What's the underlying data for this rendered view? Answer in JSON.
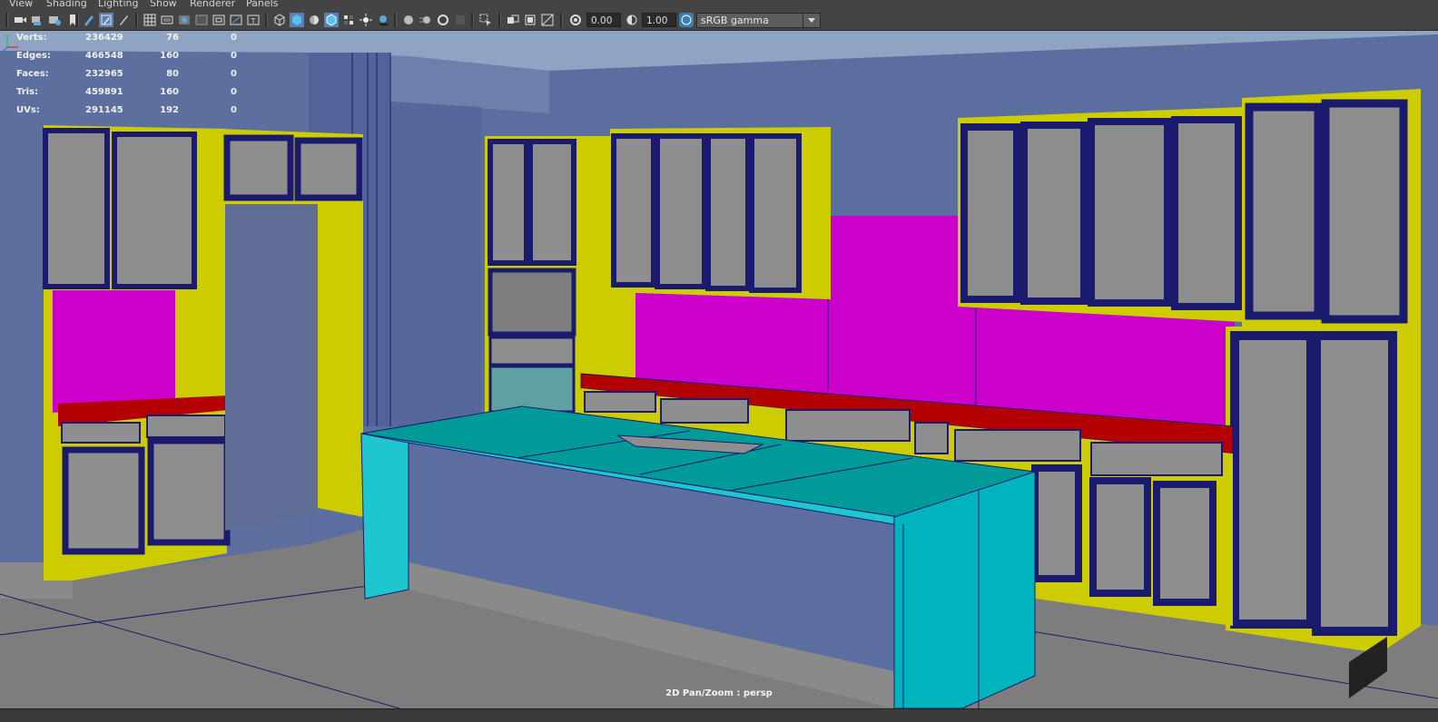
{
  "menu": [
    "View",
    "Shading",
    "Lighting",
    "Show",
    "Renderer",
    "Panels"
  ],
  "toolbar": {
    "exposure_value": "0.00",
    "gamma_value": "1.00",
    "color_space": "sRGB gamma",
    "icons": [
      "camera-icon",
      "camera-attr-icon",
      "bookmark-icon",
      "image-plane-icon",
      "grid-icon",
      "film-gate-icon",
      "resolution-gate-icon",
      "gate-mask-icon",
      "field-chart-icon",
      "safe-action-icon",
      "safe-title-icon",
      "wireframe-icon",
      "smooth-shade-icon",
      "default-material-icon",
      "wireframe-on-shaded-icon",
      "xray-icon",
      "use-all-lights-icon",
      "shadows-icon",
      "screen-space-ao-icon",
      "motion-blur-icon",
      "multisample-aa-icon",
      "depth-of-field-icon",
      "isolate-select-icon",
      "xray-joints-icon",
      "xray-active-icon",
      "exposure-icon",
      "gamma-icon",
      "color-management-icon"
    ]
  },
  "hud": {
    "rows": [
      {
        "label": "Verts:",
        "values": [
          "236429",
          "76",
          "0"
        ]
      },
      {
        "label": "Edges:",
        "values": [
          "466548",
          "160",
          "0"
        ]
      },
      {
        "label": "Faces:",
        "values": [
          "232965",
          "80",
          "0"
        ]
      },
      {
        "label": "Tris:",
        "values": [
          "459891",
          "160",
          "0"
        ]
      },
      {
        "label": "UVs:",
        "values": [
          "291145",
          "192",
          "0"
        ]
      }
    ],
    "camera_label": "2D Pan/Zoom : persp"
  },
  "colors": {
    "cabinet_yellow": "#cccc00",
    "backsplash_magenta": "#cc00cc",
    "countertop_red": "#b30000",
    "island_cyan": "#00b4bd",
    "island_top": "#009a98",
    "wall_blue": "#5b6ea0",
    "floor_gray": "#7d7d7d",
    "door_gray": "#8e8e8e",
    "frame_navy": "#1a1a6e"
  }
}
